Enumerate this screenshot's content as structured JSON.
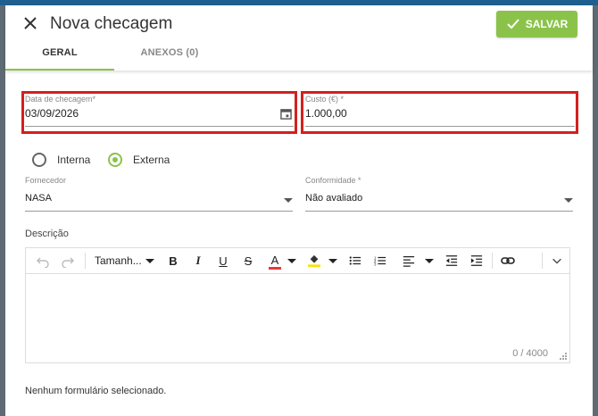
{
  "dialog": {
    "title": "Nova checagem",
    "save_label": "SALVAR",
    "tabs": [
      {
        "label": "GERAL"
      },
      {
        "label": "ANEXOS (0)"
      }
    ]
  },
  "form": {
    "date": {
      "label": "Data de checagem*",
      "value": "03/09/2026"
    },
    "cost": {
      "label": "Custo (€) *",
      "value": "1.000,00"
    },
    "type_options": [
      {
        "label": "Interna",
        "selected": false
      },
      {
        "label": "Externa",
        "selected": true
      }
    ],
    "supplier": {
      "label": "Fornecedor",
      "value": "NASA"
    },
    "conformity": {
      "label": "Conformidade *",
      "value": "Não avaliado"
    },
    "description": {
      "label": "Descrição",
      "font_size_label": "Tamanh...",
      "counter": "0 / 4000"
    },
    "no_form_text": "Nenhum formulário selecionado."
  },
  "colors": {
    "accent": "#8bc34a",
    "highlight": "#d3201f",
    "font_color_bar": "#e53935",
    "highlight_color_bar": "#f5e500"
  }
}
